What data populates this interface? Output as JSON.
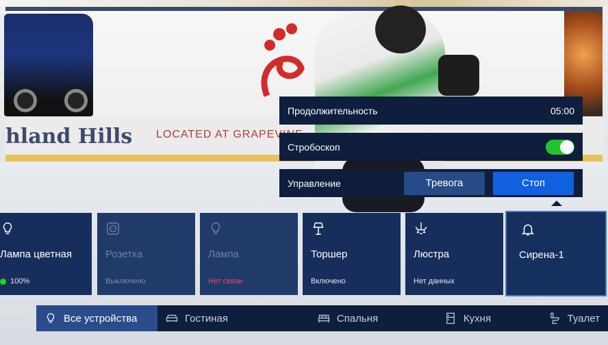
{
  "popup": {
    "duration_label": "Продолжительность",
    "duration_value": "05:00",
    "strobe_label": "Стробоскоп",
    "strobe_on": true,
    "control_label": "Управление",
    "alarm_button": "Тревога",
    "stop_button": "Стоп"
  },
  "devices": [
    {
      "name": "Лампа цветная",
      "status": "100%",
      "icon": "bulb-icon",
      "state": "on"
    },
    {
      "name": "Розетка",
      "status": "Выключено",
      "icon": "socket-icon",
      "state": "disabled"
    },
    {
      "name": "Лампа",
      "status": "Нет связи",
      "icon": "bulb-icon",
      "state": "offline"
    },
    {
      "name": "Торшер",
      "status": "Включено",
      "icon": "floor-lamp-icon",
      "state": "on"
    },
    {
      "name": "Люстра",
      "status": "Нет данных",
      "icon": "chandelier-icon",
      "state": "unknown"
    },
    {
      "name": "Сирена-1",
      "status": "",
      "icon": "bell-icon",
      "state": "selected"
    }
  ],
  "rooms": [
    {
      "label": "Все устройства",
      "icon": "bulb-icon",
      "active": true
    },
    {
      "label": "Гостиная",
      "icon": "sofa-icon",
      "active": false
    },
    {
      "label": "Спальня",
      "icon": "bed-icon",
      "active": false
    },
    {
      "label": "Кухня",
      "icon": "fridge-icon",
      "active": false
    },
    {
      "label": "Туалет",
      "icon": "toilet-icon",
      "active": false
    }
  ],
  "background": {
    "board_text_1": "hland Hills",
    "board_text_2": "LOCATED AT GRAPEVINE"
  },
  "colors": {
    "panel": "#0e1e3c",
    "card": "#172e5c",
    "active_tab": "#2a4c8a",
    "stop_button": "#1060e0",
    "toggle_on": "#22c32c",
    "status_online": "#22d42e",
    "status_error": "#ff3f6a"
  }
}
